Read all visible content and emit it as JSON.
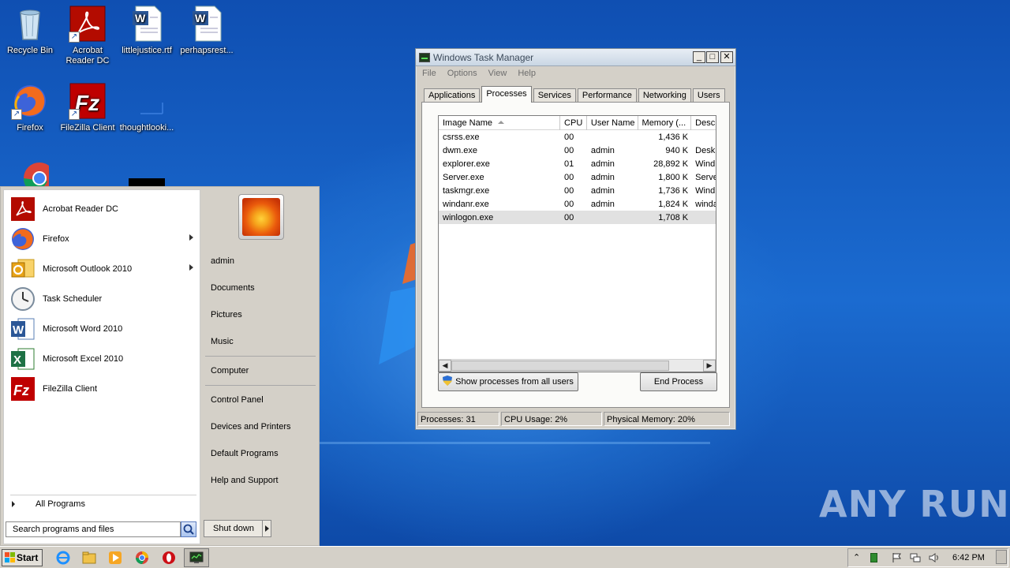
{
  "desktop": {
    "icons": [
      {
        "label": "Recycle Bin",
        "name": "recycle-bin-icon"
      },
      {
        "label": "Acrobat Reader DC",
        "name": "acrobat-icon"
      },
      {
        "label": "littlejustice.rtf",
        "name": "word-doc-icon"
      },
      {
        "label": "perhapsrest...",
        "name": "word-doc-icon"
      },
      {
        "label": "Firefox",
        "name": "firefox-icon"
      },
      {
        "label": "FileZilla Client",
        "name": "filezilla-icon"
      },
      {
        "label": "thoughtlooki...",
        "name": "blank-file-icon"
      }
    ],
    "watermark": "ANY RUN"
  },
  "taskmgr": {
    "title": "Windows Task Manager",
    "menu": [
      "File",
      "Options",
      "View",
      "Help"
    ],
    "tabs": [
      "Applications",
      "Processes",
      "Services",
      "Performance",
      "Networking",
      "Users"
    ],
    "active_tab": "Processes",
    "columns": [
      "Image Name",
      "CPU",
      "User Name",
      "Memory (...",
      "Desc"
    ],
    "rows": [
      {
        "image": "csrss.exe",
        "cpu": "00",
        "user": "",
        "mem": "1,436 K",
        "desc": ""
      },
      {
        "image": "dwm.exe",
        "cpu": "00",
        "user": "admin",
        "mem": "940 K",
        "desc": "Desk"
      },
      {
        "image": "explorer.exe",
        "cpu": "01",
        "user": "admin",
        "mem": "28,892 K",
        "desc": "Wind"
      },
      {
        "image": "Server.exe",
        "cpu": "00",
        "user": "admin",
        "mem": "1,800 K",
        "desc": "Serve"
      },
      {
        "image": "taskmgr.exe",
        "cpu": "00",
        "user": "admin",
        "mem": "1,736 K",
        "desc": "Wind"
      },
      {
        "image": "windanr.exe",
        "cpu": "00",
        "user": "admin",
        "mem": "1,824 K",
        "desc": "winda"
      },
      {
        "image": "winlogon.exe",
        "cpu": "00",
        "user": "",
        "mem": "1,708 K",
        "desc": ""
      }
    ],
    "show_all_button": "Show processes from all users",
    "end_process_button": "End Process",
    "status": {
      "processes": "Processes: 31",
      "cpu": "CPU Usage: 2%",
      "memory": "Physical Memory: 20%"
    }
  },
  "start_menu": {
    "programs": [
      {
        "label": "Acrobat Reader DC",
        "submenu": false
      },
      {
        "label": "Firefox",
        "submenu": true
      },
      {
        "label": "Microsoft Outlook 2010",
        "submenu": true
      },
      {
        "label": "Task Scheduler",
        "submenu": false
      },
      {
        "label": "Microsoft Word 2010",
        "submenu": false
      },
      {
        "label": "Microsoft Excel 2010",
        "submenu": false
      },
      {
        "label": "FileZilla Client",
        "submenu": false
      }
    ],
    "all_programs": "All Programs",
    "search_placeholder": "Search programs and files",
    "right_items": [
      "admin",
      "Documents",
      "Pictures",
      "Music",
      "Computer",
      "Control Panel",
      "Devices and Printers",
      "Default Programs",
      "Help and Support"
    ],
    "shutdown": "Shut down"
  },
  "taskbar": {
    "start_label": "Start",
    "clock": "6:42 PM"
  }
}
